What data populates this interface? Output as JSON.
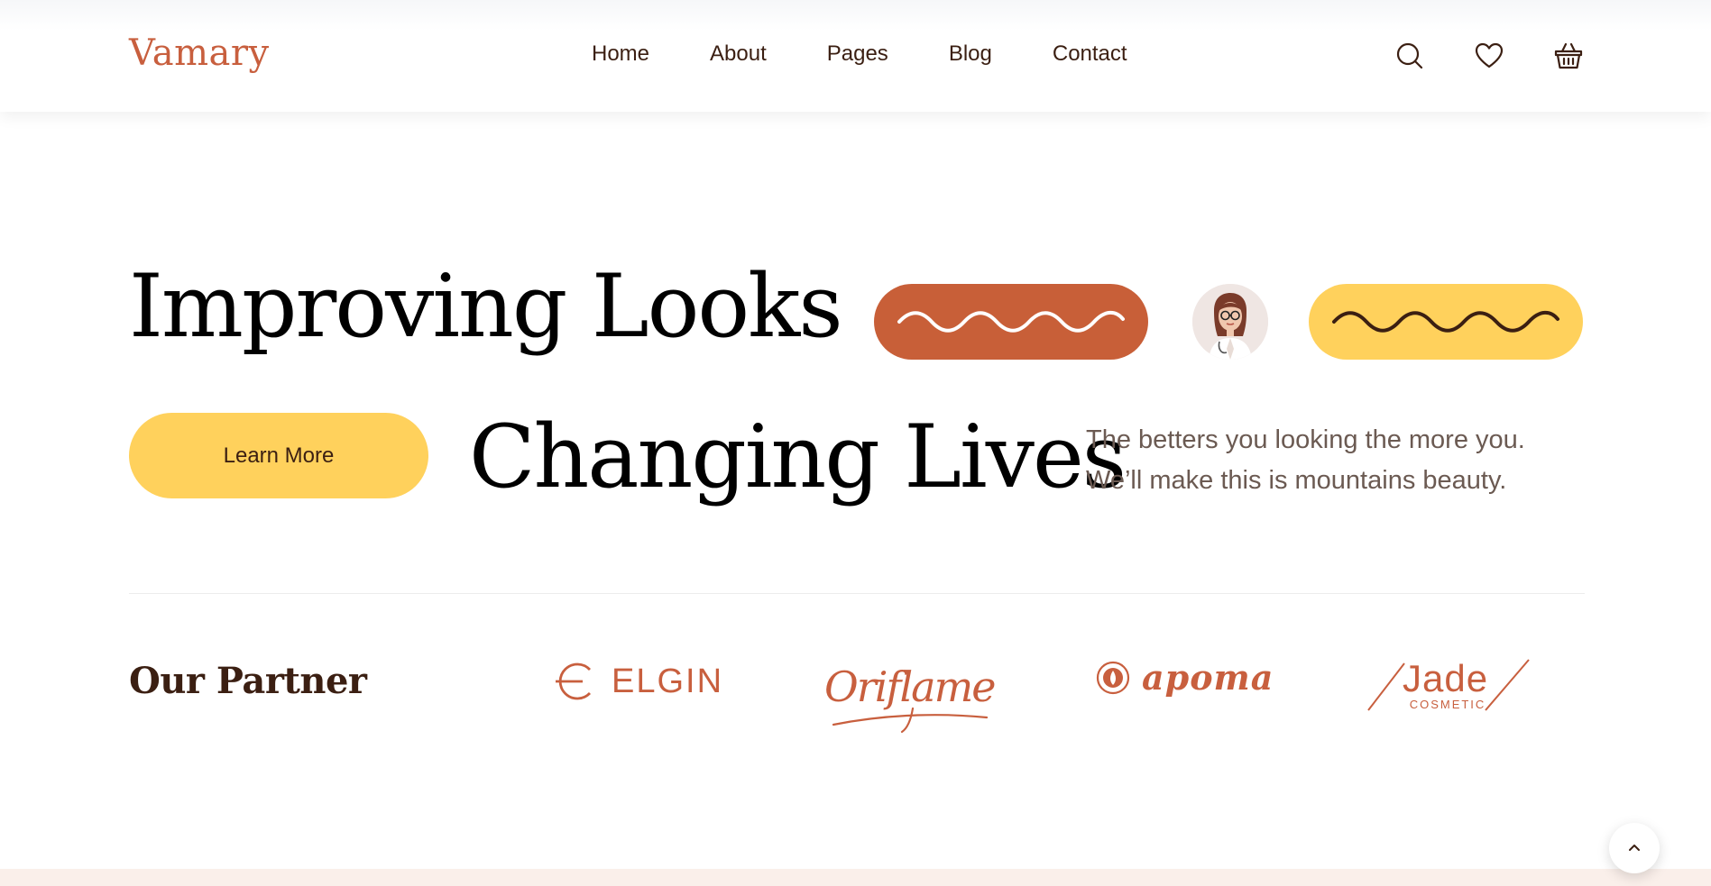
{
  "brand": {
    "logo": "Vamary",
    "accent": "#c85f38",
    "yellow": "#ffd15c",
    "dark": "#3b1f12"
  },
  "nav": {
    "items": [
      "Home",
      "About",
      "Pages",
      "Blog",
      "Contact"
    ]
  },
  "header_icons": [
    "search-icon",
    "heart-icon",
    "basket-icon"
  ],
  "hero": {
    "title_line1": "Improving Looks",
    "title_line2": "Changing Lives",
    "cta_label": "Learn More",
    "description_line1": "The betters you looking the more you.",
    "description_line2": "We’ll make this is mountains beauty."
  },
  "partners": {
    "title": "Our Partner",
    "logos": [
      {
        "name": "ELGIN",
        "icon": "elgin-logo"
      },
      {
        "name": "Oriflame",
        "icon": "oriflame-logo"
      },
      {
        "name": "apoma",
        "icon": "apoma-logo"
      },
      {
        "name": "Jade",
        "sub": "COSMETIC",
        "icon": "jade-logo"
      }
    ]
  },
  "scroll_top": {
    "icon": "chevron-up-icon"
  }
}
